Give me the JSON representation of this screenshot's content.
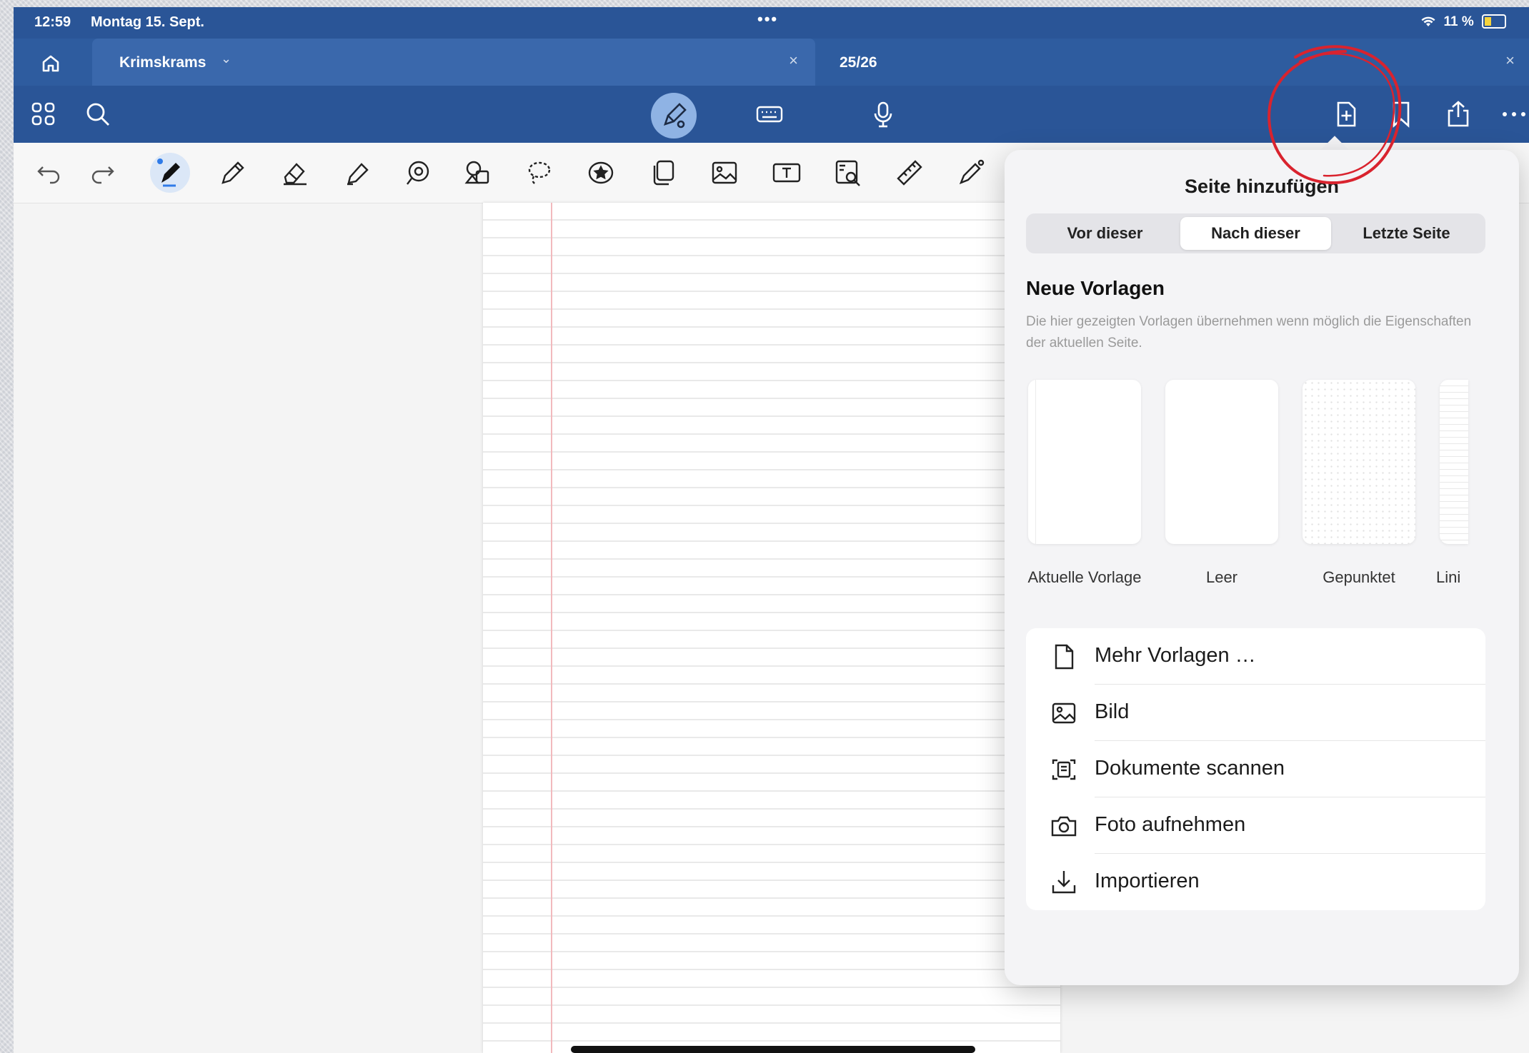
{
  "status_bar": {
    "time": "12:59",
    "date": "Montag 15. Sept.",
    "dots": "•••",
    "battery": "11 %"
  },
  "tabs": [
    {
      "title": "Krimskrams",
      "has_dropdown": true,
      "close": "×"
    },
    {
      "title": "25/26",
      "close": "×"
    }
  ],
  "toolbar": {
    "left_icons": [
      "grid-icon",
      "search-icon"
    ],
    "center_icons": [
      "pen-mode-icon",
      "keyboard-icon",
      "microphone-icon"
    ],
    "right_icons": [
      "add-page-icon",
      "bookmark-icon",
      "share-icon",
      "more-icon"
    ]
  },
  "tools": [
    "undo-icon",
    "redo-icon",
    "pen-icon",
    "pencil-icon",
    "eraser-icon",
    "highlighter-icon",
    "shape-icon",
    "element-icon",
    "lasso-icon",
    "sticker-icon",
    "copy-icon",
    "image-icon",
    "textbox-icon",
    "screenshot-icon",
    "ruler-icon",
    "laser-pointer-icon"
  ],
  "popover": {
    "title": "Seite hinzufügen",
    "segments": [
      "Vor dieser",
      "Nach dieser",
      "Letzte Seite"
    ],
    "selected_segment": "Nach dieser",
    "section_title": "Neue Vorlagen",
    "section_description": "Die hier gezeigten Vorlagen übernehmen wenn möglich die Eigenschaften der aktuellen Seite.",
    "templates": [
      "Aktuelle Vorlage",
      "Leer",
      "Gepunktet",
      "Lini"
    ],
    "menu": [
      {
        "label": "Mehr Vorlagen …",
        "icon": "document-icon"
      },
      {
        "label": "Bild",
        "icon": "image-icon"
      },
      {
        "label": "Dokumente scannen",
        "icon": "scan-icon"
      },
      {
        "label": "Foto aufnehmen",
        "icon": "camera-icon"
      },
      {
        "label": "Importieren",
        "icon": "import-icon"
      }
    ]
  },
  "colors": {
    "header_blue": "#2a5597",
    "annotation_red": "#d9232e"
  }
}
